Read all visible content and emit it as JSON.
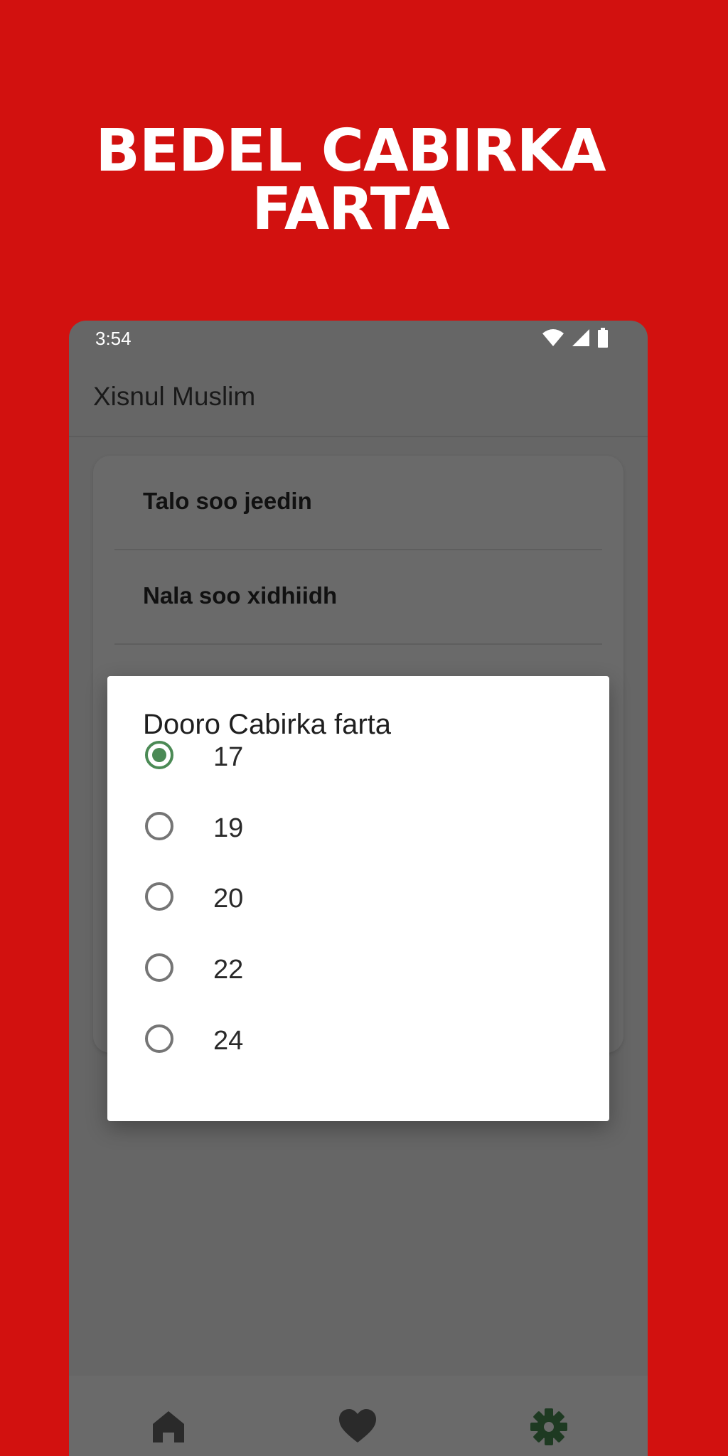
{
  "promo": {
    "title_line1": "BEDEL CABIRKA",
    "title_line2": "FARTA"
  },
  "status_bar": {
    "time": "3:54",
    "icons": [
      "wifi-icon",
      "signal-icon",
      "battery-icon"
    ]
  },
  "app_bar": {
    "title": "Xisnul Muslim"
  },
  "settings": {
    "items": [
      {
        "label": "Talo soo jeedin"
      },
      {
        "label": "Nala soo xidhiidh"
      }
    ]
  },
  "dialog": {
    "title": "Dooro Cabirka farta",
    "options": [
      {
        "label": "17",
        "selected": true
      },
      {
        "label": "19",
        "selected": false
      },
      {
        "label": "20",
        "selected": false
      },
      {
        "label": "22",
        "selected": false
      },
      {
        "label": "24",
        "selected": false
      }
    ]
  },
  "bottom_nav": {
    "items": [
      {
        "icon": "home-icon",
        "active": false
      },
      {
        "icon": "heart-icon",
        "active": false
      },
      {
        "icon": "gear-icon",
        "active": true
      }
    ]
  },
  "colors": {
    "background": "#d2110f",
    "accent": "#4b8a55",
    "active_nav": "#1e3a22"
  }
}
